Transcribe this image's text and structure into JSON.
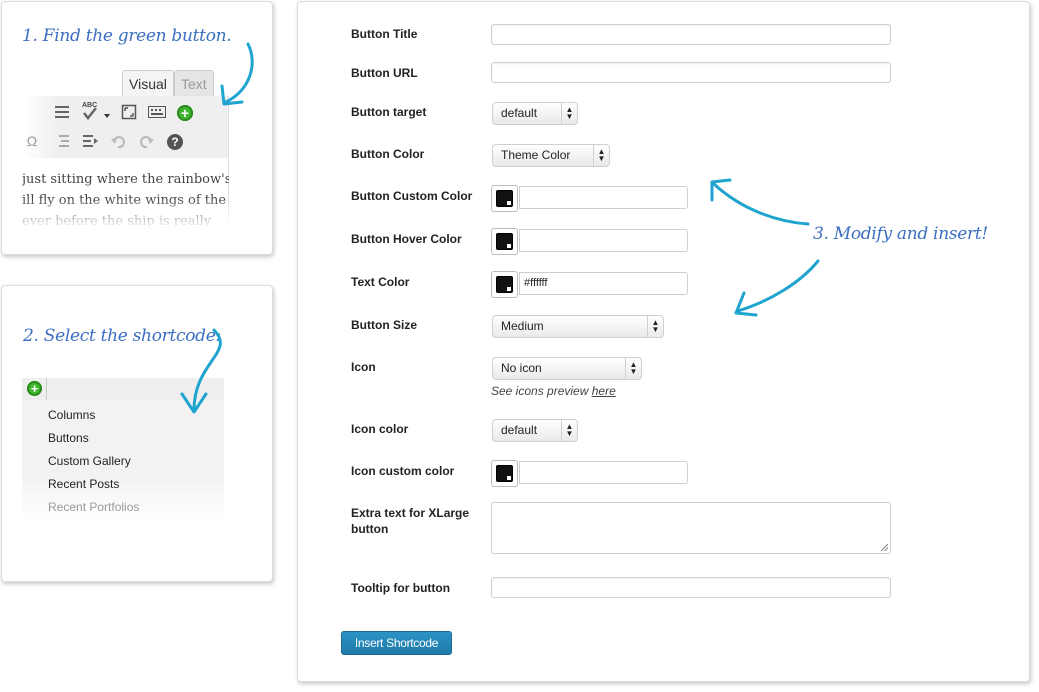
{
  "colors": {
    "accent_arrow": "#1fa3cf",
    "hand_text": "#3b6fc0",
    "insert_button": "#2a8bbd",
    "green_button": "#3fb62e"
  },
  "step1": {
    "caption": "1. Find the green button.",
    "tabs": {
      "visual": "Visual",
      "text": "Text"
    },
    "toolbar_icons": [
      "horizontal-rule-icon",
      "spellcheck-icon",
      "fullscreen-icon",
      "keyboard-icon",
      "green-add-shortcode-icon",
      "special-char-icon",
      "outdent-icon",
      "indent-icon",
      "undo-icon",
      "redo-icon",
      "help-icon"
    ],
    "spellcheck_label": "ABC",
    "omega": "Ω",
    "body_lines": [
      "just sitting where the rainbow's",
      "ill fly on the white wings of the",
      "ever before the ship is really"
    ]
  },
  "step2": {
    "caption": "2. Select the shortcode:",
    "items": [
      "Columns",
      "Buttons",
      "Custom Gallery",
      "Recent Posts",
      "Recent Portfolios"
    ]
  },
  "step3": {
    "caption": "3. Modify and insert!"
  },
  "form": {
    "button_title": {
      "label": "Button Title",
      "value": ""
    },
    "button_url": {
      "label": "Button URL",
      "value": ""
    },
    "button_target": {
      "label": "Button target",
      "value": "default"
    },
    "button_color": {
      "label": "Button Color",
      "value": "Theme Color"
    },
    "button_custom_color": {
      "label": "Button Custom Color",
      "value": ""
    },
    "button_hover_color": {
      "label": "Button Hover Color",
      "value": ""
    },
    "text_color": {
      "label": "Text Color",
      "value": "#ffffff"
    },
    "button_size": {
      "label": "Button Size",
      "value": "Medium"
    },
    "icon": {
      "label": "Icon",
      "value": "No icon",
      "note": "See icons preview ",
      "note_link": "here"
    },
    "icon_color": {
      "label": "Icon color",
      "value": "default"
    },
    "icon_custom_color": {
      "label": "Icon custom color",
      "value": ""
    },
    "extra_text": {
      "label": "Extra text for XLarge button",
      "value": ""
    },
    "tooltip": {
      "label": "Tooltip for button",
      "value": ""
    },
    "insert_button": "Insert Shortcode"
  }
}
